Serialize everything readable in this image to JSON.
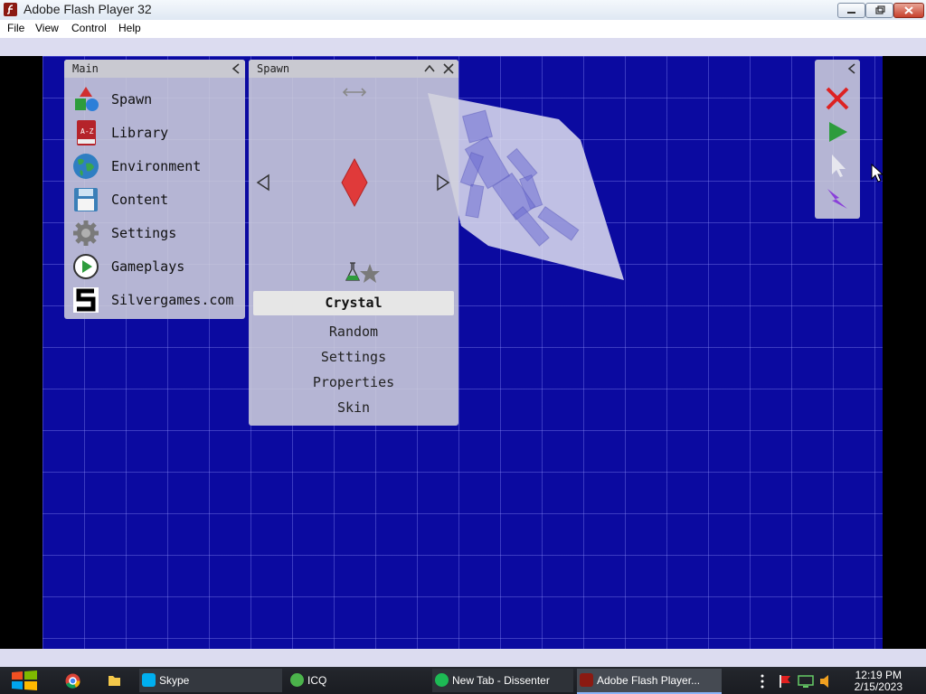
{
  "window": {
    "title": "Adobe Flash Player 32"
  },
  "menu": {
    "items": [
      "File",
      "View",
      "Control",
      "Help"
    ]
  },
  "main_panel": {
    "title": "Main",
    "items": [
      {
        "label": "Spawn",
        "icon": "shapes-icon"
      },
      {
        "label": "Library",
        "icon": "book-icon"
      },
      {
        "label": "Environment",
        "icon": "globe-icon"
      },
      {
        "label": "Content",
        "icon": "floppy-icon"
      },
      {
        "label": "Settings",
        "icon": "gear-icon"
      },
      {
        "label": "Gameplays",
        "icon": "play-icon"
      },
      {
        "label": "Silvergames.com",
        "icon": "silvergames-logo-icon"
      }
    ],
    "library_icon_text": "A-Z"
  },
  "spawn_panel": {
    "title": "Spawn",
    "selected": "Crystal",
    "buttons": [
      "Random",
      "Settings",
      "Properties",
      "Skin"
    ]
  },
  "toolbar": {
    "tools": [
      "close-x-icon",
      "play-icon",
      "cursor-icon",
      "lightning-icon"
    ]
  },
  "taskbar": {
    "tasks": [
      "Skype",
      "ICQ",
      "New Tab - Dissenter",
      "Adobe Flash Player..."
    ],
    "time": "12:19 PM",
    "date": "2/15/2023"
  },
  "colors": {
    "stage_blue": "#0b0aa0",
    "crystal_red": "#e03a3a"
  }
}
